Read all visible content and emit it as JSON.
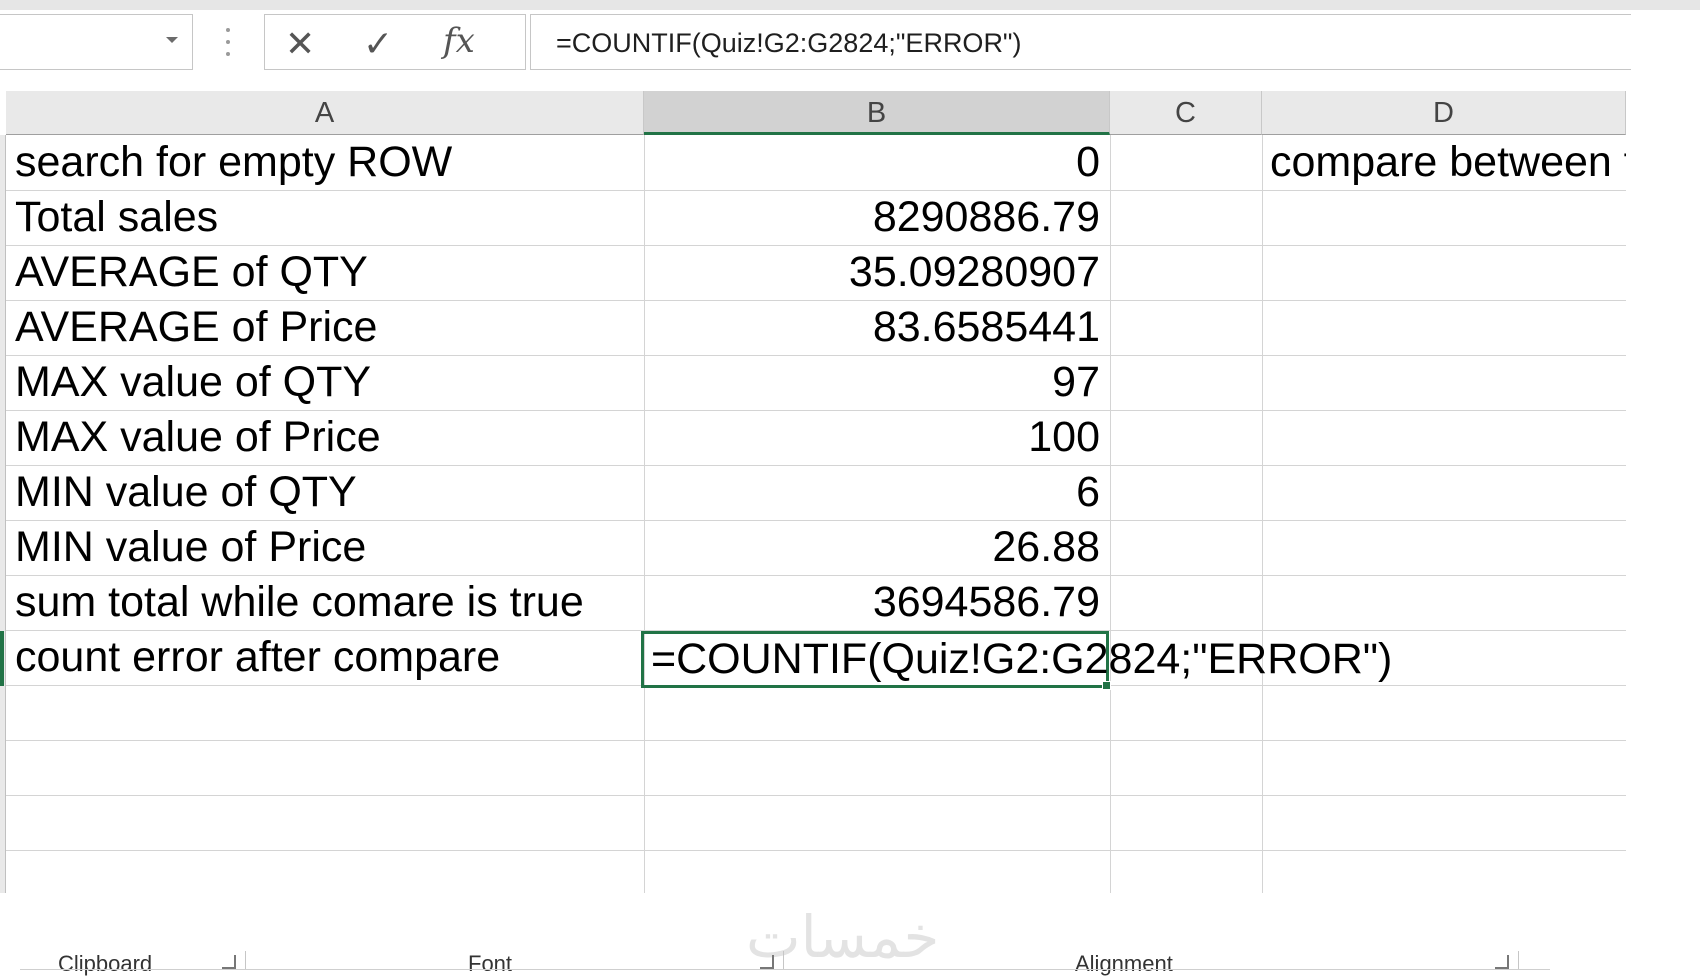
{
  "formula_bar": {
    "name_box_value": "",
    "cancel_glyph": "✕",
    "enter_glyph": "✓",
    "function_label": "fx",
    "formula": "=COUNTIF(Quiz!G2:G2824;\"ERROR\")"
  },
  "columns": [
    "A",
    "B",
    "C",
    "D"
  ],
  "selected_column": "B",
  "rows": [
    {
      "a": "search for empty ROW",
      "b": "0",
      "d": "compare between t"
    },
    {
      "a": "Total sales",
      "b": "8290886.79",
      "d": ""
    },
    {
      "a": "AVERAGE of QTY",
      "b": "35.09280907",
      "d": ""
    },
    {
      "a": "AVERAGE of Price",
      "b": "83.6585441",
      "d": ""
    },
    {
      "a": "MAX value of QTY",
      "b": "97",
      "d": ""
    },
    {
      "a": "MAX value of Price",
      "b": "100",
      "d": ""
    },
    {
      "a": "MIN value of QTY",
      "b": "6",
      "d": ""
    },
    {
      "a": "MIN value of Price",
      "b": "26.88",
      "d": ""
    },
    {
      "a": "sum total while comare is true",
      "b": "3694586.79",
      "d": ""
    },
    {
      "a": "count error after compare",
      "b": "",
      "d": ""
    }
  ],
  "active_cell_text": "=COUNTIF(Quiz!G2:G2824;\"ERROR\")",
  "ribbon_groups": [
    "Clipboard",
    "Font",
    "Alignment"
  ],
  "watermark": "خمسات",
  "colors": {
    "accent": "#217346"
  }
}
